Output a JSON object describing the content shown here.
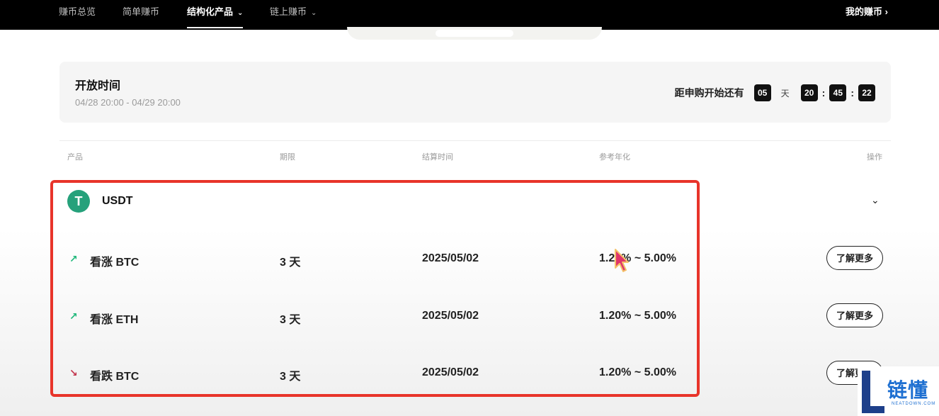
{
  "nav": {
    "items": [
      {
        "label": "赚币总览",
        "active": false,
        "dropdown": false
      },
      {
        "label": "简单赚币",
        "active": false,
        "dropdown": false
      },
      {
        "label": "结构化产品",
        "active": true,
        "dropdown": true
      },
      {
        "label": "链上赚币",
        "active": false,
        "dropdown": true
      }
    ],
    "right_link": "我的赚币 ›"
  },
  "open_period": {
    "title": "开放时间",
    "range": "04/28 20:00 - 04/29 20:00",
    "countdown_label": "距申购开始还有",
    "days": "05",
    "day_unit": "天",
    "hours": "20",
    "minutes": "45",
    "seconds": "22",
    "separator": ":"
  },
  "table": {
    "headers": {
      "product": "产品",
      "term": "期限",
      "settlement": "结算时间",
      "apr": "参考年化",
      "action": "操作"
    },
    "asset": {
      "name": "USDT",
      "logo_glyph": "T",
      "logo_color": "#26a17b",
      "toggle": "⌄"
    },
    "rows": [
      {
        "trend_icon": "↗",
        "trend": "up",
        "product": "看涨 BTC",
        "term": "3 天",
        "settlement": "2025/05/02",
        "apr": "1.20% ~ 5.00%",
        "action": "了解更多"
      },
      {
        "trend_icon": "↗",
        "trend": "up",
        "product": "看涨 ETH",
        "term": "3 天",
        "settlement": "2025/05/02",
        "apr": "1.20% ~ 5.00%",
        "action": "了解更多"
      },
      {
        "trend_icon": "↘",
        "trend": "down",
        "product": "看跌 BTC",
        "term": "3 天",
        "settlement": "2025/05/02",
        "apr": "1.20% ~ 5.00%",
        "action": "了解更多"
      }
    ]
  },
  "colors": {
    "highlight": "#e8342a",
    "up": "#1fb77a",
    "down": "#c2334b"
  },
  "watermark": {
    "text": "链懂",
    "sub": "NEATDOWN.COM"
  }
}
